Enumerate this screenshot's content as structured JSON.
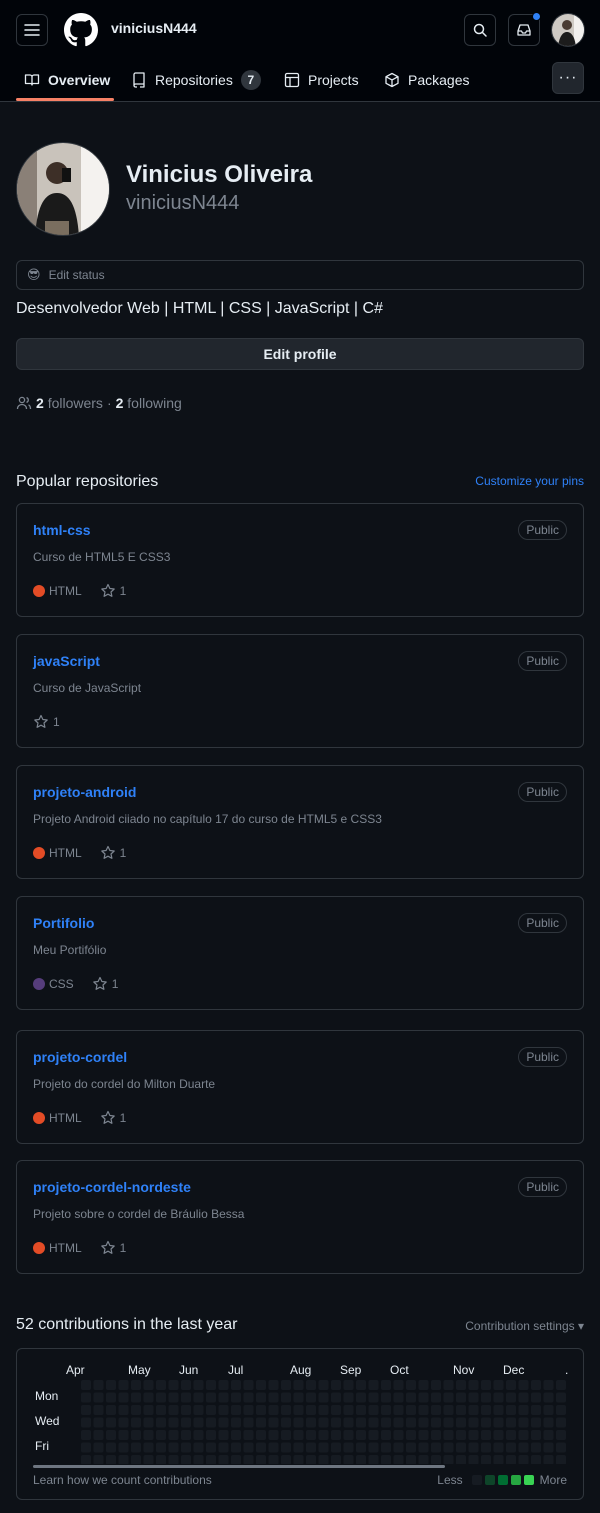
{
  "header": {
    "username": "viniciusN444",
    "icons": [
      "menu-icon",
      "github-logo",
      "search-icon",
      "inbox-icon",
      "avatar"
    ]
  },
  "tabs": [
    {
      "label": "Overview",
      "icon": "book-icon",
      "active": true
    },
    {
      "label": "Repositories",
      "icon": "repo-icon",
      "count": "7"
    },
    {
      "label": "Projects",
      "icon": "table-icon"
    },
    {
      "label": "Packages",
      "icon": "package-icon"
    }
  ],
  "more_label": "···",
  "profile": {
    "full_name": "Vinicius Oliveira",
    "login": "viniciusN444",
    "status_emoji": "😎",
    "status_label": "Edit status",
    "bio": "Desenvolvedor Web | HTML | CSS | JavaScript | C#",
    "edit_profile_label": "Edit profile",
    "followers_count": "2",
    "followers_label": "followers",
    "separator": "·",
    "following_count": "2",
    "following_label": "following"
  },
  "popular": {
    "title": "Popular repositories",
    "customize_label": "Customize your pins",
    "repos": [
      {
        "name": "html-css",
        "badge": "Public",
        "description": "Curso de HTML5 E CSS3",
        "language": "HTML",
        "lang_color": "#e34c26",
        "stars": "1"
      },
      {
        "name": "javaScript",
        "badge": "Public",
        "description": "Curso de JavaScript",
        "language": "",
        "lang_color": "",
        "stars": "1"
      },
      {
        "name": "projeto-android",
        "badge": "Public",
        "description": "Projeto Android ciiado no capítulo 17 do curso de HTML5 e CSS3",
        "language": "HTML",
        "lang_color": "#e34c26",
        "stars": "1"
      },
      {
        "name": "Portifolio",
        "badge": "Public",
        "description": "Meu Portifólio",
        "language": "CSS",
        "lang_color": "#563d7c",
        "stars": "1"
      },
      {
        "name": "projeto-cordel",
        "badge": "Public",
        "description": "Projeto do cordel do Milton Duarte",
        "language": "HTML",
        "lang_color": "#e34c26",
        "stars": "1"
      },
      {
        "name": "projeto-cordel-nordeste",
        "badge": "Public",
        "description": "Projeto sobre o cordel de Bráulio Bessa",
        "language": "HTML",
        "lang_color": "#e34c26",
        "stars": "1"
      }
    ]
  },
  "contributions": {
    "title": "52 contributions in the last year",
    "settings_label": "Contribution settings ▾",
    "months": [
      "Apr",
      "May",
      "Jun",
      "Jul",
      "Aug",
      "Sep",
      "Oct",
      "Nov",
      "Dec",
      "."
    ],
    "days": [
      "Mon",
      "Wed",
      "Fri"
    ],
    "learn_label": "Learn how we count contributions",
    "less_label": "Less",
    "more_label": "More",
    "legend_colors": [
      "#161b22",
      "#0e4429",
      "#006d32",
      "#26a641",
      "#39d353"
    ],
    "empty_color": "#161b22"
  }
}
